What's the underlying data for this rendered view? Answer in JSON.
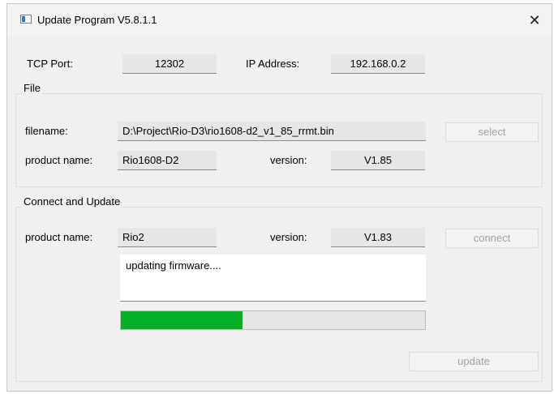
{
  "window": {
    "title": "Update Program V5.8.1.1",
    "close_glyph": "✕"
  },
  "network": {
    "tcp_port_label": "TCP Port:",
    "tcp_port_value": "12302",
    "ip_label": "IP Address:",
    "ip_value": "192.168.0.2"
  },
  "file": {
    "group_title": "File",
    "filename_label": "filename:",
    "filename_value": "D:\\Project\\Rio-D3\\rio1608-d2_v1_85_rrmt.bin",
    "select_label": "select",
    "product_label": "product name:",
    "product_value": "Rio1608-D2",
    "version_label": "version:",
    "version_value": "V1.85"
  },
  "connect": {
    "group_title": "Connect and Update",
    "product_label": "product name:",
    "product_value": "Rio2",
    "version_label": "version:",
    "version_value": "V1.83",
    "connect_label": "connect",
    "status_text": "updating firmware....",
    "progress_fraction": 0.4,
    "progress_color": "#06b025",
    "update_label": "update"
  }
}
